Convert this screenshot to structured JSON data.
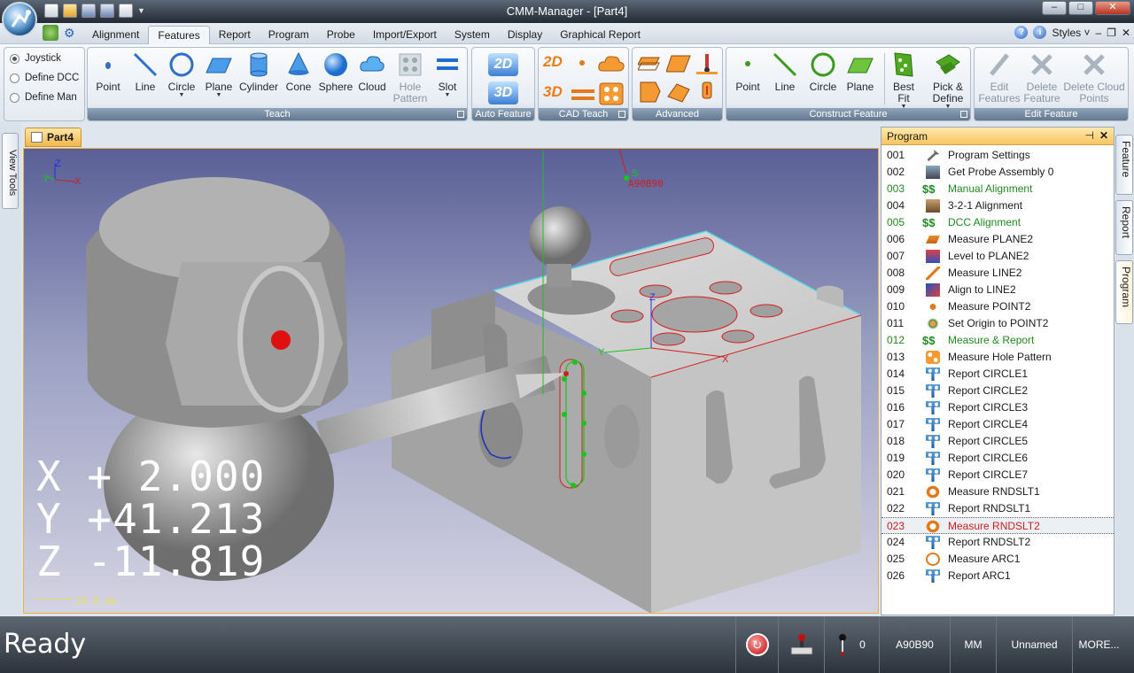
{
  "window": {
    "title": "CMM-Manager - [Part4]",
    "controls": [
      "–",
      "□",
      "✕"
    ]
  },
  "ribbon_tabs": [
    "Alignment",
    "Features",
    "Report",
    "Program",
    "Probe",
    "Import/Export",
    "System",
    "Display",
    "Graphical Report"
  ],
  "active_tab": "Features",
  "styles_label": "Styles",
  "motion_modes": [
    "Joystick",
    "Define DCC",
    "Define Man"
  ],
  "teach": {
    "caption": "Teach",
    "buttons": [
      "Point",
      "Line",
      "Circle",
      "Plane",
      "Cylinder",
      "Cone",
      "Sphere",
      "Cloud",
      "Hole Pattern",
      "Slot"
    ]
  },
  "auto_feature": {
    "caption": "Auto Feature",
    "buttons": [
      "2D",
      "3D"
    ]
  },
  "cad_teach": {
    "caption": "CAD Teach",
    "labels": [
      "2D",
      "3D"
    ]
  },
  "advanced": {
    "caption": "Advanced"
  },
  "construct": {
    "caption": "Construct Feature",
    "buttons": [
      "Point",
      "Line",
      "Circle",
      "Plane",
      "Best Fit",
      "Pick & Define"
    ]
  },
  "edit_feature": {
    "caption": "Edit Feature",
    "buttons": [
      "Edit Features",
      "Delete Feature",
      "Delete Cloud Points"
    ]
  },
  "side_tabs": {
    "left": "View Tools",
    "right": [
      "Feature",
      "Report",
      "Program"
    ]
  },
  "document_tab": "Part4",
  "viewport": {
    "dro": {
      "x_label": "X",
      "x_value": "+ 2.000",
      "y_label": "Y",
      "y_value": "+41.213",
      "z_label": "Z",
      "z_value": "-11.819"
    },
    "scale_label": "10.0 mm",
    "probe_label": "A90B90",
    "s_label": "S",
    "triad": {
      "x": "X",
      "y": "Y",
      "z": "Z"
    }
  },
  "program": {
    "title": "Program",
    "selected": "023",
    "steps": [
      {
        "num": "001",
        "label": "Program Settings",
        "icon": "wrench-icon",
        "style": "normal"
      },
      {
        "num": "002",
        "label": "Get Probe Assembly 0",
        "icon": "probe-assembly-icon",
        "style": "normal"
      },
      {
        "num": "003",
        "label": "Manual Alignment",
        "icon": "dollar-icon",
        "style": "green"
      },
      {
        "num": "004",
        "label": "3-2-1 Alignment",
        "icon": "alignment-icon",
        "style": "normal"
      },
      {
        "num": "005",
        "label": "DCC Alignment",
        "icon": "dollar-icon",
        "style": "green"
      },
      {
        "num": "006",
        "label": "Measure PLANE2",
        "icon": "plane-icon",
        "style": "normal"
      },
      {
        "num": "007",
        "label": "Level to PLANE2",
        "icon": "level-icon",
        "style": "normal"
      },
      {
        "num": "008",
        "label": "Measure LINE2",
        "icon": "line-icon",
        "style": "normal"
      },
      {
        "num": "009",
        "label": "Align to LINE2",
        "icon": "align-icon",
        "style": "normal"
      },
      {
        "num": "010",
        "label": "Measure POINT2",
        "icon": "point-icon",
        "style": "normal"
      },
      {
        "num": "011",
        "label": "Set Origin to POINT2",
        "icon": "origin-icon",
        "style": "normal"
      },
      {
        "num": "012",
        "label": "Measure & Report",
        "icon": "dollar-icon",
        "style": "green"
      },
      {
        "num": "013",
        "label": "Measure Hole Pattern",
        "icon": "hole-pattern-icon",
        "style": "normal"
      },
      {
        "num": "014",
        "label": "Report CIRCLE1",
        "icon": "report-icon",
        "style": "normal"
      },
      {
        "num": "015",
        "label": "Report CIRCLE2",
        "icon": "report-icon",
        "style": "normal"
      },
      {
        "num": "016",
        "label": "Report CIRCLE3",
        "icon": "report-icon",
        "style": "normal"
      },
      {
        "num": "017",
        "label": "Report CIRCLE4",
        "icon": "report-icon",
        "style": "normal"
      },
      {
        "num": "018",
        "label": "Report CIRCLE5",
        "icon": "report-icon",
        "style": "normal"
      },
      {
        "num": "019",
        "label": "Report CIRCLE6",
        "icon": "report-icon",
        "style": "normal"
      },
      {
        "num": "020",
        "label": "Report CIRCLE7",
        "icon": "report-icon",
        "style": "normal"
      },
      {
        "num": "021",
        "label": "Measure RNDSLT1",
        "icon": "slot-icon",
        "style": "normal"
      },
      {
        "num": "022",
        "label": "Report RNDSLT1",
        "icon": "report-icon",
        "style": "normal"
      },
      {
        "num": "023",
        "label": "Measure RNDSLT2",
        "icon": "slot-icon",
        "style": "selected"
      },
      {
        "num": "024",
        "label": "Report RNDSLT2",
        "icon": "report-icon",
        "style": "normal"
      },
      {
        "num": "025",
        "label": "Measure ARC1",
        "icon": "arc-icon",
        "style": "normal"
      },
      {
        "num": "026",
        "label": "Report ARC1",
        "icon": "report-icon",
        "style": "normal"
      }
    ]
  },
  "status": {
    "text": "Ready",
    "counter": "0",
    "probe": "A90B90",
    "units": "MM",
    "name": "Unnamed",
    "more": "MORE..."
  },
  "colors": {
    "accent_orange": "#f3b649",
    "green_step": "#1f8a1f",
    "selected_step": "#d01d1d",
    "viewport_top": "#5a5f96",
    "part_edge": "#e01818"
  }
}
